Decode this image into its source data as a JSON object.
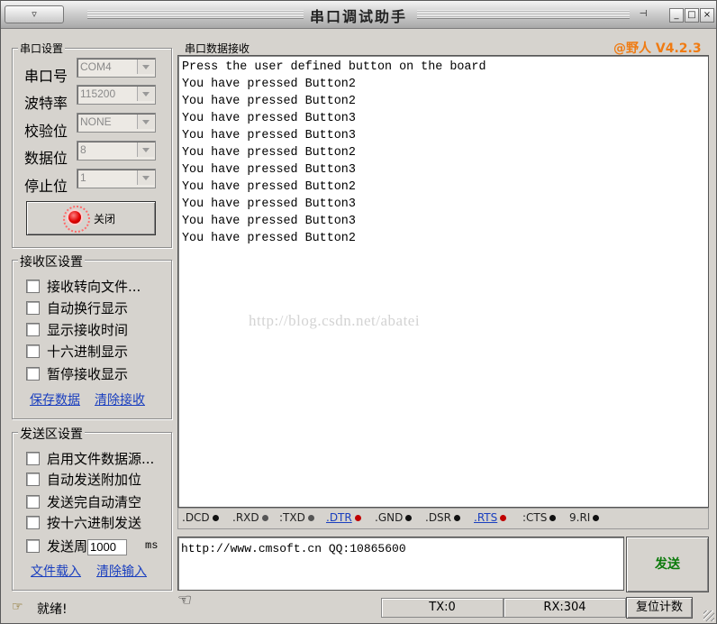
{
  "window": {
    "title": "串口调试助手",
    "version": "@野人 V4.2.3",
    "controls": {
      "pin": "⊣",
      "minimize": "_",
      "maximize": "□",
      "close": "×"
    },
    "menu_icon": "menu-icon"
  },
  "serial_settings": {
    "title": "串口设置",
    "rows": [
      {
        "label": "串口号",
        "value": "COM4"
      },
      {
        "label": "波特率",
        "value": "115200"
      },
      {
        "label": "校验位",
        "value": "NONE"
      },
      {
        "label": "数据位",
        "value": "8"
      },
      {
        "label": "停止位",
        "value": "1"
      }
    ],
    "close_button": "关闭",
    "led_color": "#e00000"
  },
  "receive_settings": {
    "title": "接收区设置",
    "options": [
      "接收转向文件...",
      "自动换行显示",
      "显示接收时间",
      "十六进制显示",
      "暂停接收显示"
    ],
    "save_link": "保存数据",
    "clear_link": "清除接收"
  },
  "send_settings": {
    "title": "发送区设置",
    "options": [
      "启用文件数据源...",
      "自动发送附加位",
      "发送完自动清空",
      "按十六进制发送"
    ],
    "period_label": "发送周",
    "period_value": "1000",
    "period_unit": "ms",
    "load_link": "文件载入",
    "clear_link": "清除输入"
  },
  "receive_panel": {
    "title": "串口数据接收",
    "lines": [
      "Press the user defined button on the board",
      "You have pressed Button2",
      "You have pressed Button2",
      "You have pressed Button3",
      "You have pressed Button3",
      "You have pressed Button2",
      "You have pressed Button3",
      "You have pressed Button2",
      "You have pressed Button3",
      "You have pressed Button3",
      "You have pressed Button2"
    ],
    "watermark": "http://blog.csdn.net/abatei"
  },
  "signals": [
    {
      "label": ".DCD",
      "dot": "#111111",
      "link": false
    },
    {
      "label": ".RXD",
      "dot": "#555555",
      "link": false
    },
    {
      "label": ":TXD",
      "dot": "#555555",
      "link": false
    },
    {
      "label": ".DTR",
      "dot": "#c00000",
      "link": true
    },
    {
      "label": ".GND",
      "dot": "#111111",
      "link": false
    },
    {
      "label": ".DSR",
      "dot": "#111111",
      "link": false
    },
    {
      "label": ".RTS",
      "dot": "#c00000",
      "link": true
    },
    {
      "label": ":CTS",
      "dot": "#111111",
      "link": false
    },
    {
      "label": "9.RI",
      "dot": "#111111",
      "link": false
    }
  ],
  "send_input": {
    "value": "http://www.cmsoft.cn QQ:10865600"
  },
  "send_button": "发送",
  "status": {
    "ready": "就绪!",
    "tx": "TX:0",
    "rx": "RX:304",
    "reset_button": "复位计数"
  }
}
